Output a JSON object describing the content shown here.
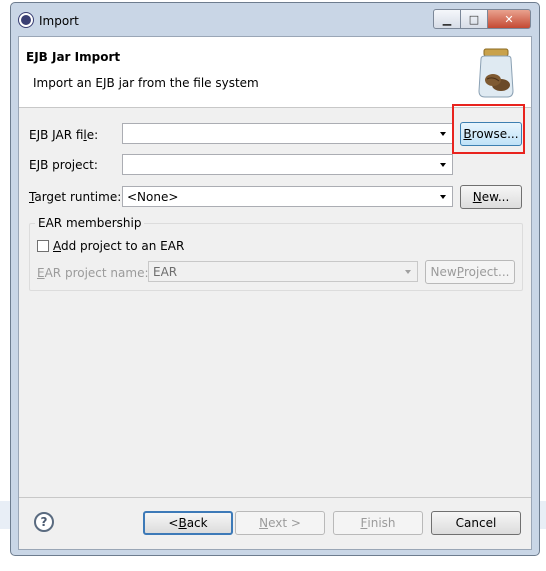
{
  "window": {
    "title": "Import"
  },
  "header": {
    "title": "EJB Jar Import",
    "description": "Import an EJB jar from the file system"
  },
  "form": {
    "jar_file_label": "EJB JAR file:",
    "jar_file_value": "",
    "browse_label": "Browse...",
    "project_label": "EJB project:",
    "project_value": "",
    "runtime_label": "Target runtime:",
    "runtime_value": "<None>",
    "new_label": "New..."
  },
  "ear": {
    "group_title": "EAR membership",
    "add_label": "Add project to an EAR",
    "add_checked": false,
    "project_name_label": "EAR project name:",
    "project_name_value": "EAR",
    "new_project_label": "New Project..."
  },
  "footer": {
    "back_label": "< Back",
    "next_label": "Next >",
    "finish_label": "Finish",
    "cancel_label": "Cancel"
  },
  "icons": [
    "app-icon",
    "jar-icon",
    "help-icon",
    "minimize-icon",
    "maximize-icon",
    "close-icon"
  ],
  "colors": {
    "highlight": "#e8231e",
    "browse_hover": "#bfe2f8"
  }
}
